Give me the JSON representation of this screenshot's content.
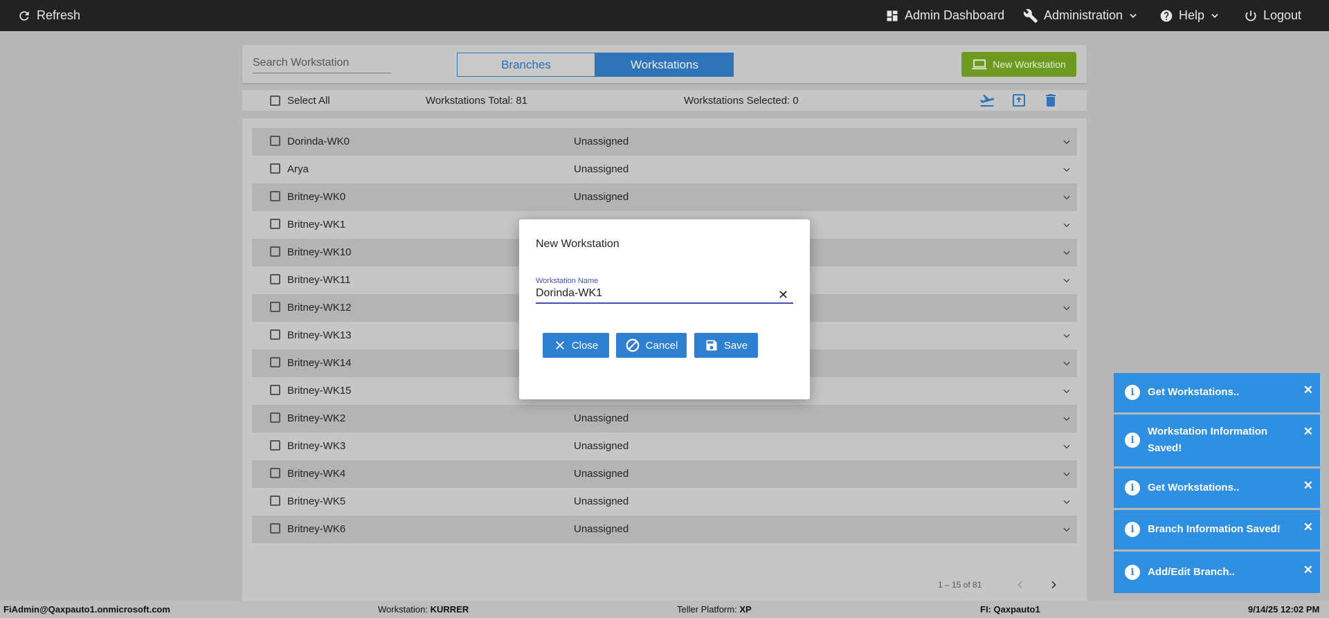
{
  "topbar": {
    "refresh": "Refresh",
    "admin_dashboard": "Admin Dashboard",
    "administration": "Administration",
    "help": "Help",
    "logout": "Logout"
  },
  "toolbar": {
    "search_placeholder": "Search Workstation",
    "tab_branches": "Branches",
    "tab_workstations": "Workstations",
    "new_workstation": "New Workstation"
  },
  "selection": {
    "select_all": "Select All",
    "total": "Workstations Total: 81",
    "selected": "Workstations Selected: 0"
  },
  "rows": [
    {
      "name": "Dorinda-WK0",
      "status": "Unassigned"
    },
    {
      "name": "Arya",
      "status": "Unassigned"
    },
    {
      "name": "Britney-WK0",
      "status": "Unassigned"
    },
    {
      "name": "Britney-WK1",
      "status": ""
    },
    {
      "name": "Britney-WK10",
      "status": ""
    },
    {
      "name": "Britney-WK11",
      "status": ""
    },
    {
      "name": "Britney-WK12",
      "status": ""
    },
    {
      "name": "Britney-WK13",
      "status": ""
    },
    {
      "name": "Britney-WK14",
      "status": ""
    },
    {
      "name": "Britney-WK15",
      "status": ""
    },
    {
      "name": "Britney-WK2",
      "status": "Unassigned"
    },
    {
      "name": "Britney-WK3",
      "status": "Unassigned"
    },
    {
      "name": "Britney-WK4",
      "status": "Unassigned"
    },
    {
      "name": "Britney-WK5",
      "status": "Unassigned"
    },
    {
      "name": "Britney-WK6",
      "status": "Unassigned"
    }
  ],
  "pager": {
    "range": "1 – 15 of 81"
  },
  "statusbar": {
    "user": "FiAdmin@Qaxpauto1.onmicrosoft.com",
    "workstation_label": "Workstation:",
    "workstation_value": "KURRER",
    "platform_label": "Teller Platform:",
    "platform_value": "XP",
    "fi_label": "FI:",
    "fi_value": "Qaxpauto1",
    "datetime": "9/14/25 12:02 PM"
  },
  "modal": {
    "title": "New Workstation",
    "field_label": "Workstation Name",
    "field_value": "Dorinda-WK1",
    "close": "Close",
    "cancel": "Cancel",
    "save": "Save"
  },
  "toasts": [
    "Get Workstations..",
    "Workstation Information Saved!",
    "Get Workstations..",
    "Branch Information Saved!",
    "Add/Edit Branch.."
  ],
  "colors": {
    "primary": "#2f74b8",
    "success": "#6e9a22",
    "toast": "#2f8fe0"
  }
}
